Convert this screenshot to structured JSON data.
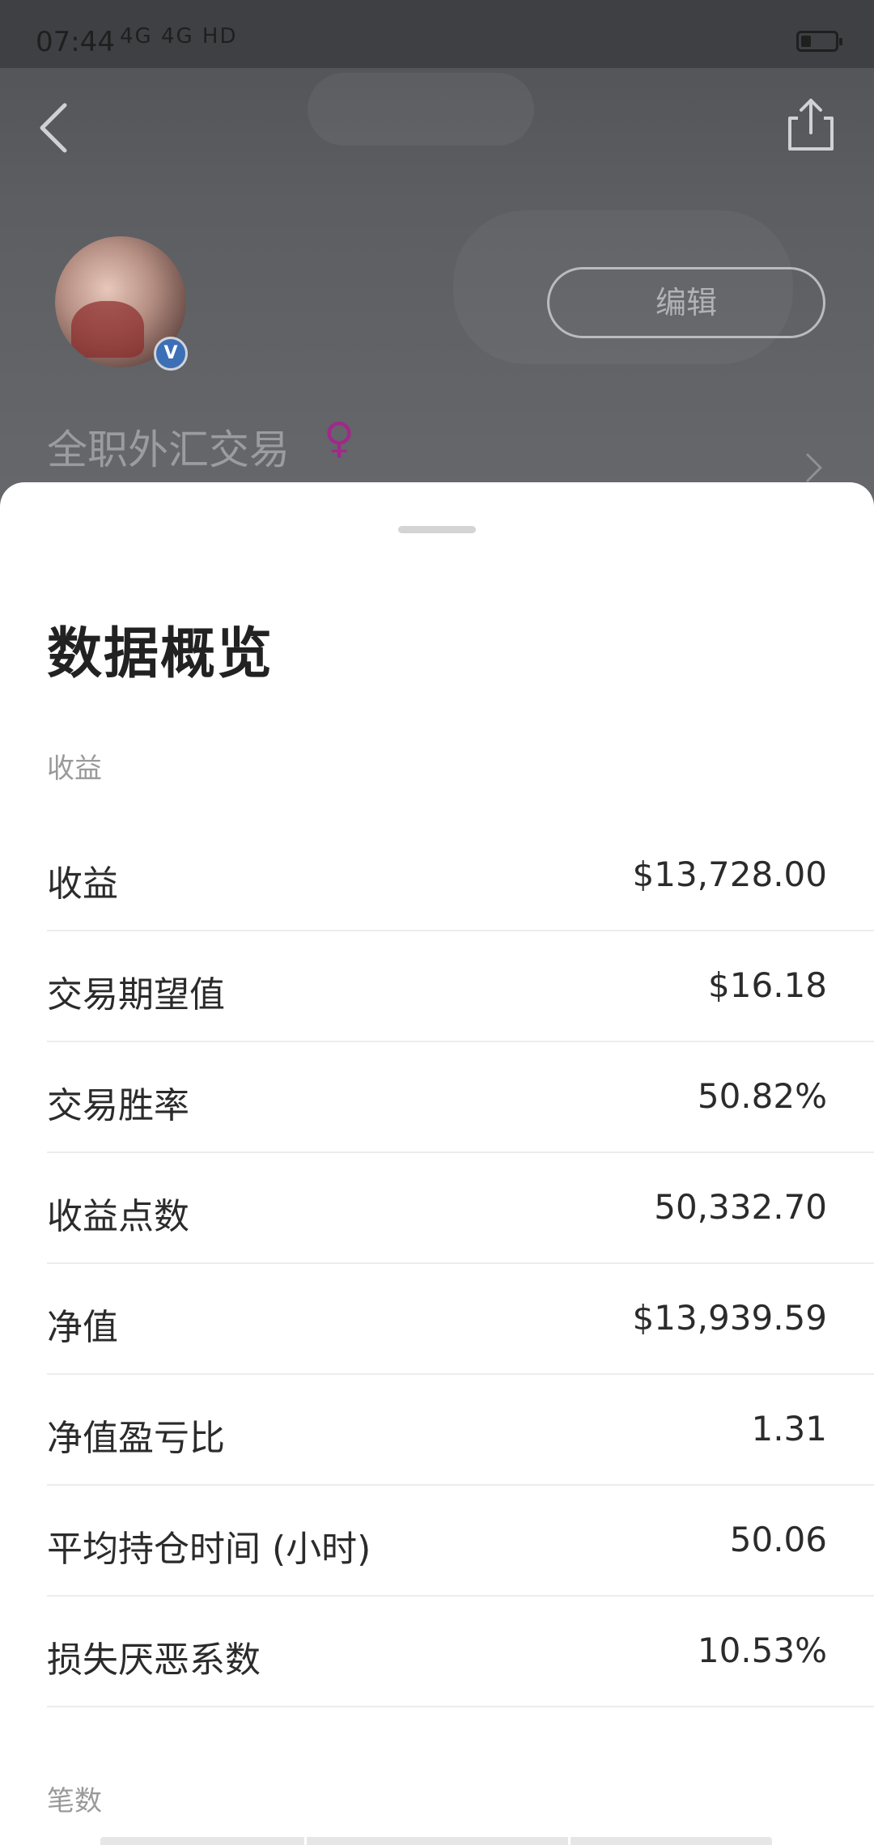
{
  "status_bar": {
    "time": "07:44",
    "signal_text": "4G 4G HD"
  },
  "profile": {
    "edit_label": "编辑",
    "username": "全职外汇交易",
    "gender_symbol": "♀",
    "verified_mark": "V"
  },
  "sheet": {
    "title": "数据概览",
    "section_income": "收益",
    "section_count": "笔数",
    "rows": [
      {
        "label": "收益",
        "value": "$13,728.00"
      },
      {
        "label": "交易期望值",
        "value": "$16.18"
      },
      {
        "label": "交易胜率",
        "value": "50.82%"
      },
      {
        "label": "收益点数",
        "value": "50,332.70"
      },
      {
        "label": "净值",
        "value": "$13,939.59"
      },
      {
        "label": "净值盈亏比",
        "value": "1.31"
      },
      {
        "label": "平均持仓时间 (小时)",
        "value": "50.06"
      },
      {
        "label": "损失厌恶系数",
        "value": "10.53%"
      }
    ]
  },
  "icons": [
    "back-arrow-icon",
    "share-icon",
    "verified-icon",
    "chevron-right-icon",
    "battery-icon"
  ]
}
